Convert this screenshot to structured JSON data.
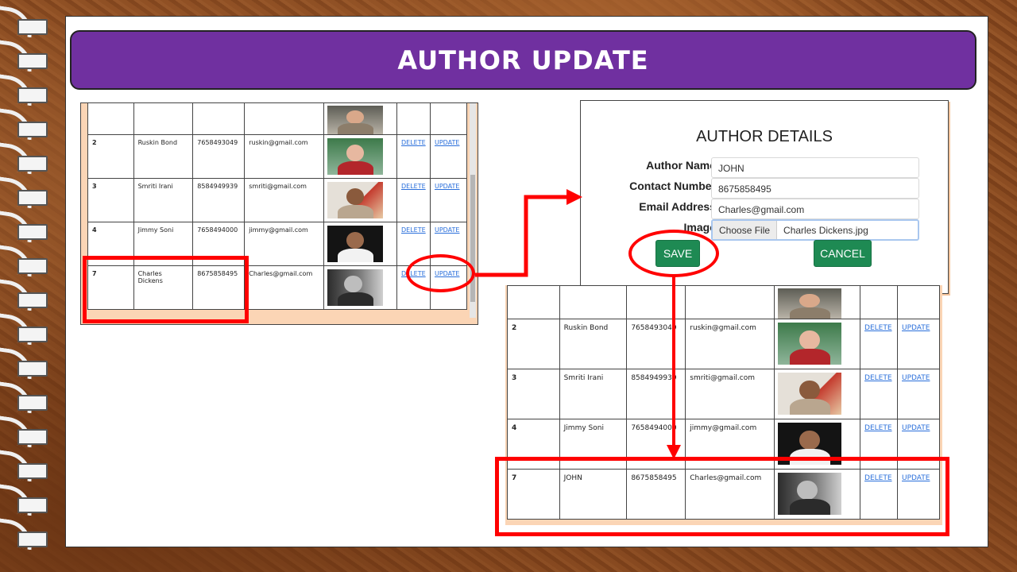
{
  "slide": {
    "title": "AUTHOR UPDATE"
  },
  "table_before": {
    "rows": [
      {
        "id": "",
        "name": "",
        "contact": "",
        "email": "",
        "photo": "author-photo-1",
        "delete": "",
        "update": ""
      },
      {
        "id": "2",
        "name": "Ruskin Bond",
        "contact": "7658493049",
        "email": "ruskin@gmail.com",
        "photo": "author-photo-2",
        "delete": "DELETE",
        "update": "UPDATE"
      },
      {
        "id": "3",
        "name": "Smriti Irani",
        "contact": "8584949939",
        "email": "smriti@gmail.com",
        "photo": "author-photo-3",
        "delete": "DELETE",
        "update": "UPDATE"
      },
      {
        "id": "4",
        "name": "Jimmy Soni",
        "contact": "7658494000",
        "email": "jimmy@gmail.com",
        "photo": "author-photo-4",
        "delete": "DELETE",
        "update": "UPDATE"
      },
      {
        "id": "7",
        "name": "Charles Dickens",
        "contact": "8675858495",
        "email": "Charles@gmail.com",
        "photo": "author-photo-7",
        "delete": "DELETE",
        "update": "UPDATE"
      }
    ]
  },
  "dialog": {
    "title": "AUTHOR DETAILS",
    "author_name_label": "Author Name",
    "author_name_value": "JOHN",
    "contact_label": "Contact Number",
    "contact_value": "8675858495",
    "email_label": "Email Address",
    "email_value": "Charles@gmail.com",
    "image_label": "Image",
    "choose_file": "Choose File",
    "file_name": "Charles Dickens.jpg",
    "save": "SAVE",
    "cancel": "CANCEL"
  },
  "table_after": {
    "rows": [
      {
        "id": "",
        "name": "",
        "contact": "",
        "email": "",
        "photo": "author-photo-1",
        "delete": "",
        "update": ""
      },
      {
        "id": "2",
        "name": "Ruskin Bond",
        "contact": "7658493049",
        "email": "ruskin@gmail.com",
        "photo": "author-photo-2",
        "delete": "DELETE",
        "update": "UPDATE"
      },
      {
        "id": "3",
        "name": "Smriti Irani",
        "contact": "8584949939",
        "email": "smriti@gmail.com",
        "photo": "author-photo-3",
        "delete": "DELETE",
        "update": "UPDATE"
      },
      {
        "id": "4",
        "name": "Jimmy Soni",
        "contact": "7658494000",
        "email": "jimmy@gmail.com",
        "photo": "author-photo-4",
        "delete": "DELETE",
        "update": "UPDATE"
      },
      {
        "id": "7",
        "name": "JOHN",
        "contact": "8675858495",
        "email": "Charles@gmail.com",
        "photo": "author-photo-7",
        "delete": "DELETE",
        "update": "UPDATE"
      }
    ]
  },
  "colors": {
    "banner": "#7030a0",
    "highlight": "#ff0000",
    "button": "#1e8a53",
    "link": "#2a6fdb"
  }
}
